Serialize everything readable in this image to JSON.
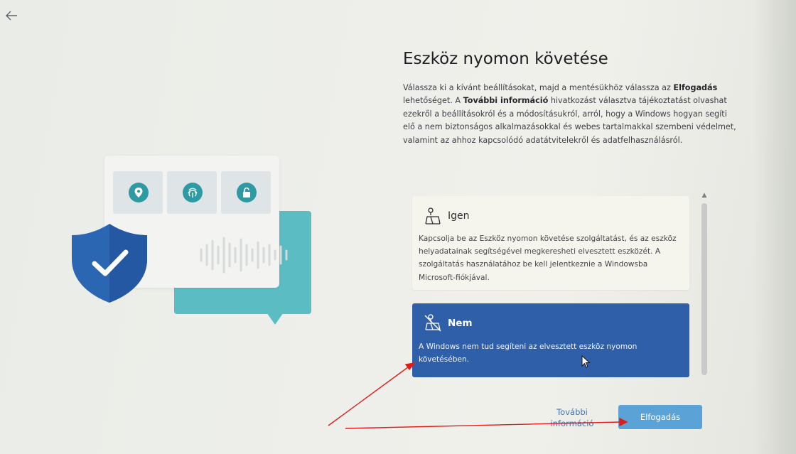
{
  "header": {
    "back_icon": "arrow-left-icon"
  },
  "page": {
    "title": "Eszköz nyomon követése",
    "description": {
      "p1": "Válassza ki a kívánt beállításokat, majd a mentésükhöz válassza az ",
      "b1": "Elfogadás",
      "p2": " lehetőséget. A ",
      "b2": "További információ",
      "p3": " hivatkozást választva tájékoztatást olvashat ezekről a beállításokról és a módosításukról, arról, hogy a Windows hogyan segíti elő a nem biztonságos alkalmazásokkal és webes tartalmakkal szembeni védelmet, valamint az ahhoz kapcsolódó adatátvitelekről és adatfelhasználásról."
    }
  },
  "illustration": {
    "icons": [
      "location-pin-icon",
      "fingerprint-icon",
      "lock-icon",
      "shield-check-icon"
    ],
    "colors": {
      "teal": "#2e9aa3",
      "shield": "#2b66b3",
      "bubble": "#5bbcc4"
    }
  },
  "options": [
    {
      "icon": "device-location-icon",
      "title": "Igen",
      "body": "Kapcsolja be az Eszköz nyomon követése szolgáltatást, és az eszköz helyadatainak segítségével megkeresheti elvesztett eszközét. A szolgáltatás használatához be kell jelentkeznie a Windowsba Microsoft-fiókjával.",
      "selected": false
    },
    {
      "icon": "device-location-off-icon",
      "title": "Nem",
      "body": "A Windows nem tud segíteni az elvesztett eszköz nyomon követésében.",
      "selected": true
    }
  ],
  "footer": {
    "more_info_label": "További információ",
    "accept_label": "Elfogadás"
  },
  "colors": {
    "selected_option": "#2f5fa8",
    "accept_button": "#5ba3d6",
    "link": "#3b73b3",
    "annotation_arrow": "#e01c1c"
  }
}
